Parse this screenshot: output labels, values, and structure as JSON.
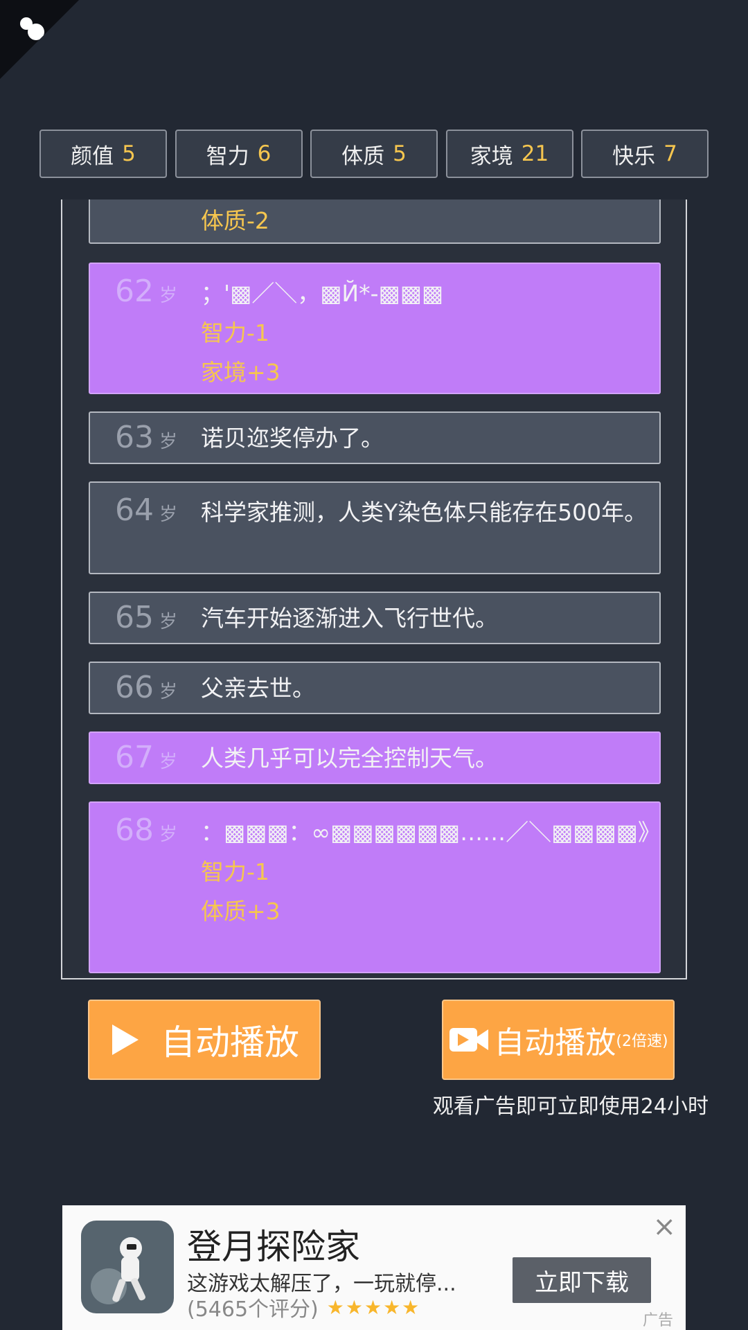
{
  "stats": [
    {
      "label": "颜值",
      "value": "5"
    },
    {
      "label": "智力",
      "value": "6"
    },
    {
      "label": "体质",
      "value": "5"
    },
    {
      "label": "家境",
      "value": "21"
    },
    {
      "label": "快乐",
      "value": "7"
    }
  ],
  "log": {
    "partial_effect": "体质-2",
    "entries": [
      {
        "age": "62",
        "unit": "岁",
        "text": "；'▩／＼，▩Й*-▩▩▩",
        "effects": [
          "智力-1",
          "家境+3"
        ]
      },
      {
        "age": "63",
        "unit": "岁",
        "text": "诺贝迩奖停办了。"
      },
      {
        "age": "64",
        "unit": "岁",
        "text": "科学家推测，人类Y染色体只能存在500年。"
      },
      {
        "age": "65",
        "unit": "岁",
        "text": "汽车开始逐渐进入飞行世代。"
      },
      {
        "age": "66",
        "unit": "岁",
        "text": "父亲去世。"
      },
      {
        "age": "67",
        "unit": "岁",
        "text": "人类几乎可以完全控制天气。"
      },
      {
        "age": "68",
        "unit": "岁",
        "text": "：▩▩▩：∞▩▩▩▩▩▩……／＼▩▩▩▩》",
        "effects": [
          "智力-1",
          "体质+3"
        ]
      }
    ]
  },
  "controls": {
    "autoplay_label": "自动播放",
    "autoplay_fast_label": "自动播放",
    "autoplay_fast_suffix": "(2倍速)",
    "hint": "观看广告即可立即使用24小时"
  },
  "ad": {
    "title": "登月探险家",
    "description": "这游戏太解压了，一玩就停...",
    "rating": "(5465个评分)",
    "stars": "★★★★★",
    "button": "立即下载",
    "label": "广告",
    "close": "×"
  },
  "colors": {
    "purple": "#c07cf8",
    "gold": "#f6c64f",
    "orange": "#fda544"
  }
}
